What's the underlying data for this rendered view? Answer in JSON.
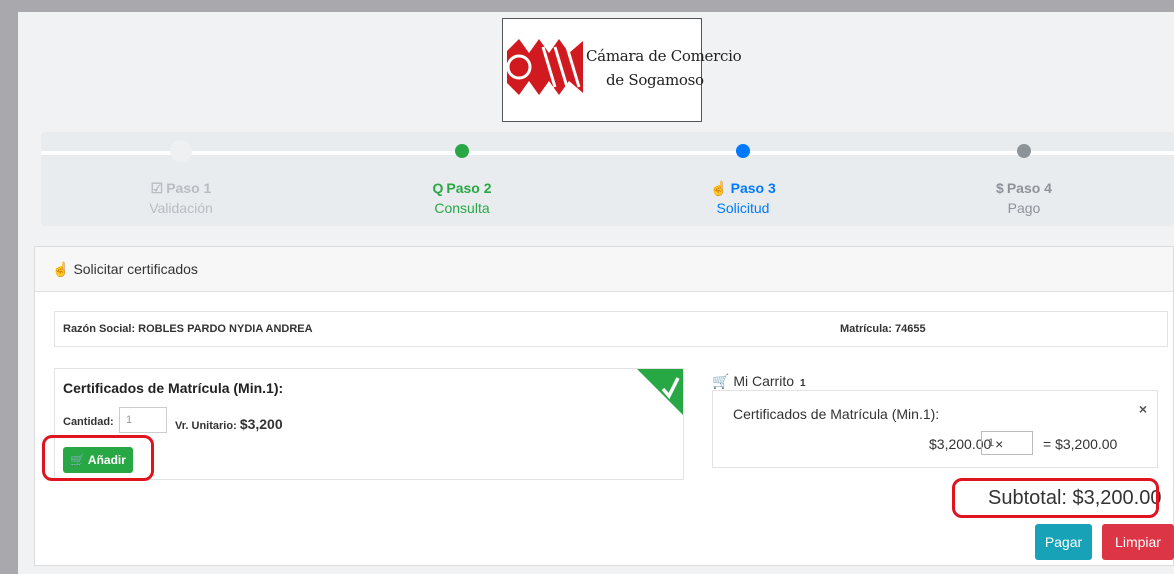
{
  "logo": {
    "line1": "Cámara de Comercio",
    "line2": "de Sogamoso"
  },
  "stepper": {
    "steps": [
      {
        "icon": "☑",
        "title": "Paso 1",
        "subtitle": "Validación",
        "state": "done",
        "color": "#b9bcc0"
      },
      {
        "icon": "Q",
        "title": "Paso 2",
        "subtitle": "Consulta",
        "state": "complete",
        "color": "#28a745"
      },
      {
        "icon": "☝",
        "title": "Paso 3",
        "subtitle": "Solicitud",
        "state": "active",
        "color": "#007bff"
      },
      {
        "icon": "$",
        "title": "Paso 4",
        "subtitle": "Pago",
        "state": "pending",
        "color": "#8d9399"
      }
    ]
  },
  "card": {
    "header": "Solicitar certificados",
    "info": {
      "razon_social": "Razón Social: ROBLES PARDO NYDIA ANDREA",
      "matricula": "Matrícula: 74655"
    },
    "product": {
      "title": "Certificados de Matrícula (Min.1):",
      "cantidad_label": "Cantidad:",
      "cantidad_value": "1",
      "unit_label": "Vr. Unitario:",
      "unit_value": "$3,200",
      "add_button": "Añadir"
    },
    "cart": {
      "label": "Mi Carrito",
      "count": "1",
      "item_title": "Certificados de Matrícula (Min.1):",
      "item_price": "$3,200.00 ×",
      "item_qty": "1",
      "item_total": "= $3,200.00",
      "close": "×",
      "subtotal": "Subtotal: $3,200.00"
    },
    "buttons": {
      "pay": "Pagar",
      "clear": "Limpiar"
    }
  }
}
